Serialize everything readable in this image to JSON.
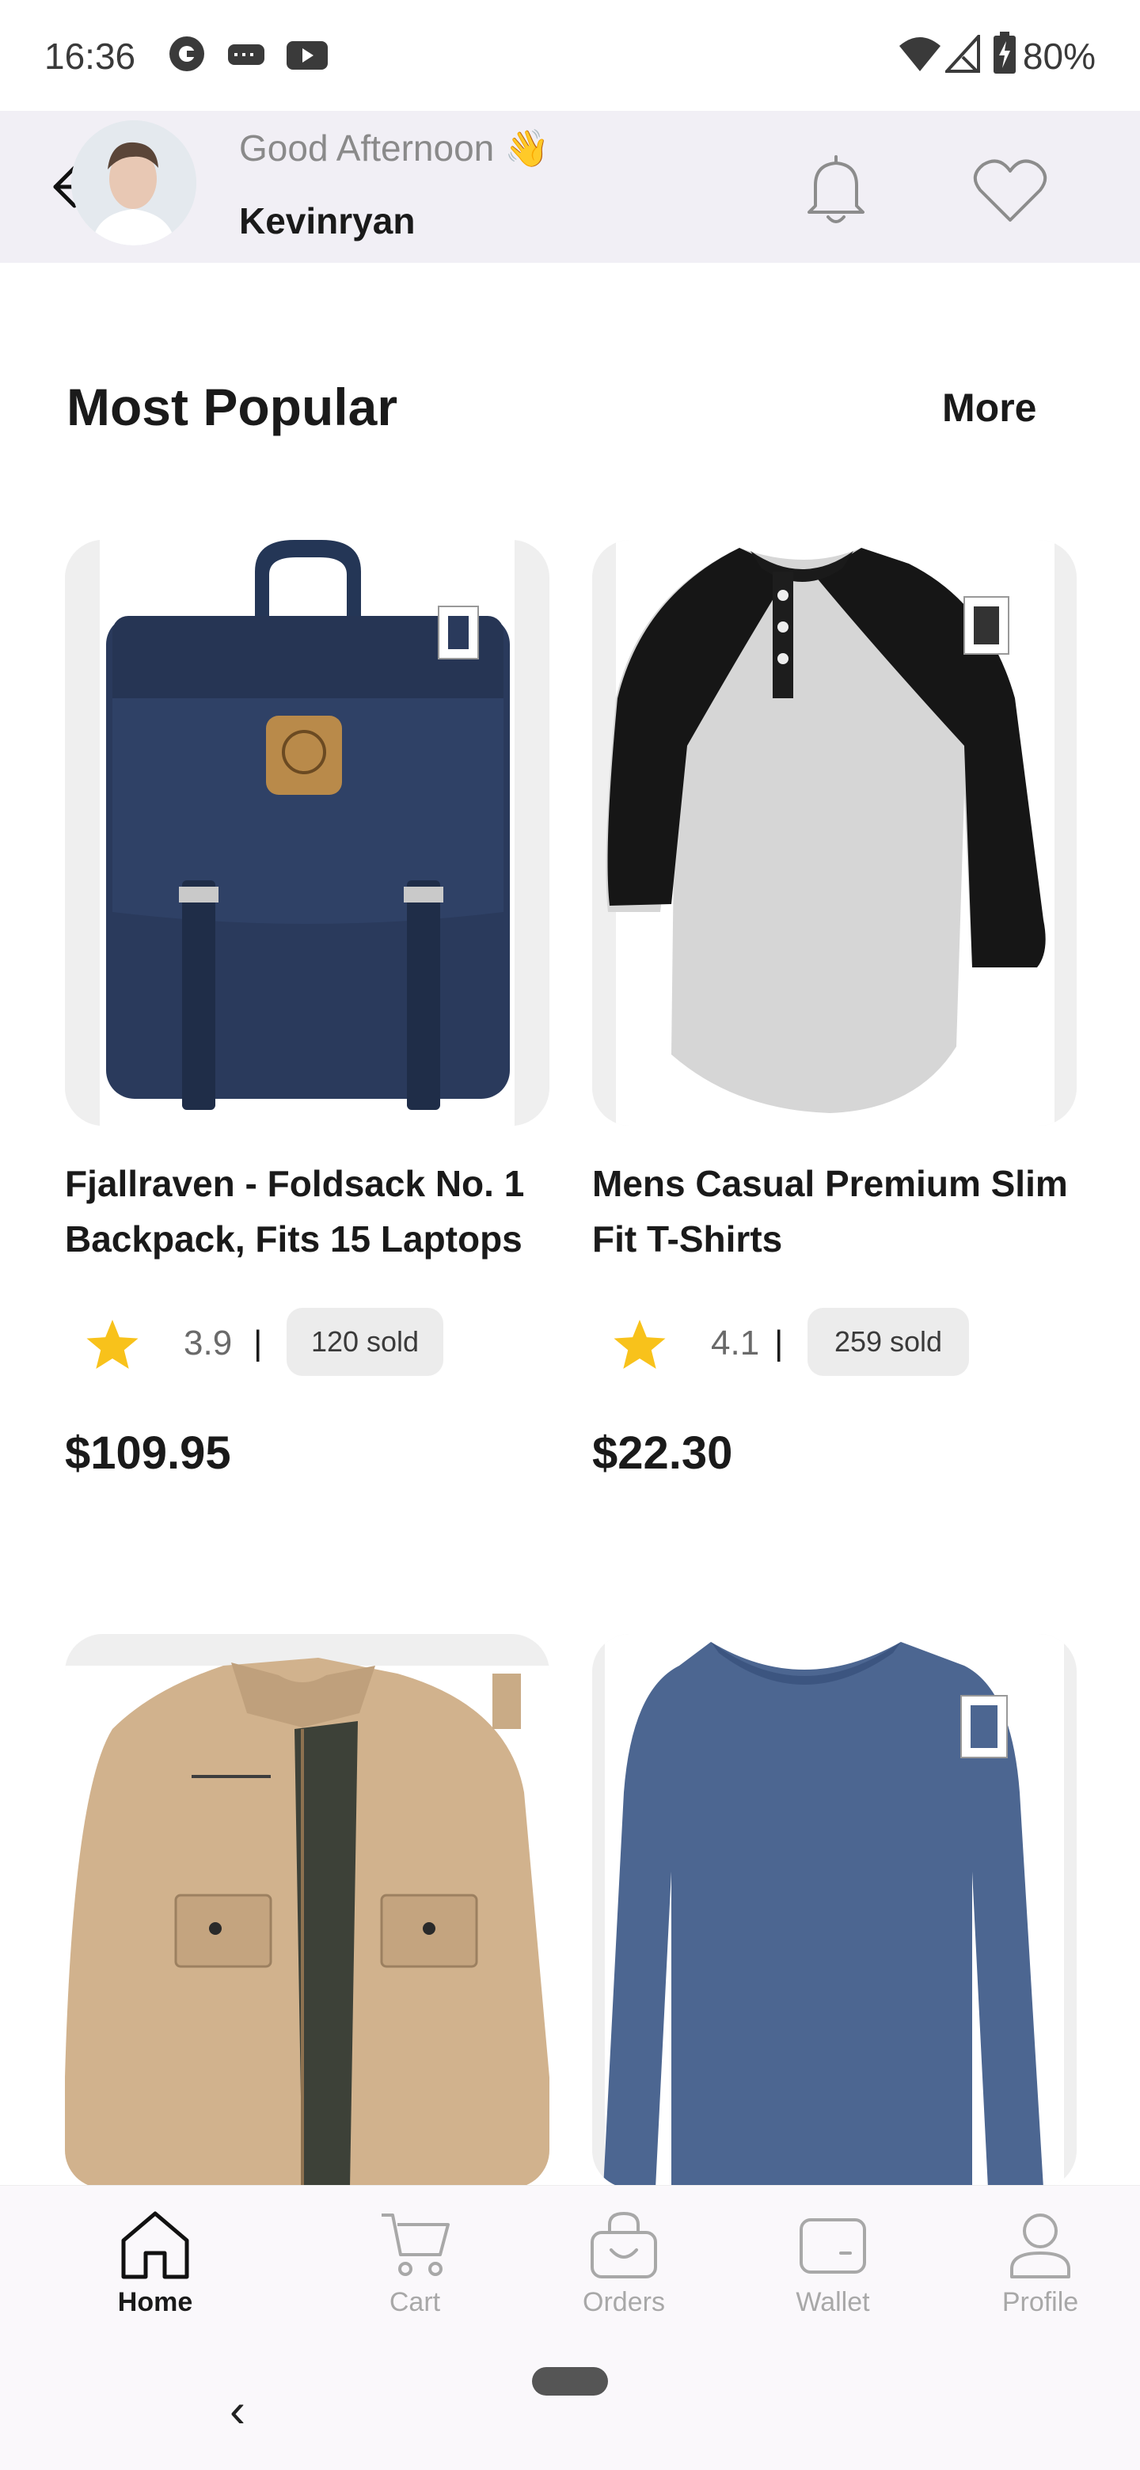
{
  "status_bar": {
    "time": "16:36",
    "battery": "80%",
    "icons": [
      "pocket-casts-icon",
      "gamepad-icon",
      "youtube-icon",
      "wifi-icon",
      "signal-icon",
      "battery-charging-icon"
    ]
  },
  "header": {
    "greeting": "Good Afternoon 👋",
    "username": "Kevinryan",
    "back_icon": "arrow-left-icon",
    "notification_icon": "bell-icon",
    "wishlist_icon": "heart-icon"
  },
  "section": {
    "title": "Most Popular",
    "more_label": "More"
  },
  "products": [
    {
      "name_line1": "Fjallraven - Foldsack No. 1",
      "name_line2": "Backpack, Fits 15 Laptops",
      "rating": "3.9",
      "separator": "|",
      "sold": "120 sold",
      "price": "$109.95",
      "image": "navy-backpack-image"
    },
    {
      "name_line1": "Mens Casual Premium Slim",
      "name_line2": "Fit T-Shirts",
      "rating": "4.1",
      "separator": "|",
      "sold": "259 sold",
      "price": "$22.30",
      "image": "raglan-tshirt-image"
    },
    {
      "image": "khaki-jacket-image"
    },
    {
      "image": "blue-longsleeve-image"
    }
  ],
  "bottom_nav": {
    "items": [
      {
        "label": "Home",
        "icon": "home-icon",
        "active": true
      },
      {
        "label": "Cart",
        "icon": "cart-icon",
        "active": false
      },
      {
        "label": "Orders",
        "icon": "bag-icon",
        "active": false
      },
      {
        "label": "Wallet",
        "icon": "wallet-icon",
        "active": false
      },
      {
        "label": "Profile",
        "icon": "user-icon",
        "active": false
      }
    ]
  },
  "system_nav": {
    "back_glyph": "‹"
  },
  "colors": {
    "header_bg": "#f1eff5",
    "star": "#f8c21b",
    "chip_bg": "#ececec",
    "text_dark": "#1a1a1a",
    "text_muted": "#a8a8a8"
  }
}
